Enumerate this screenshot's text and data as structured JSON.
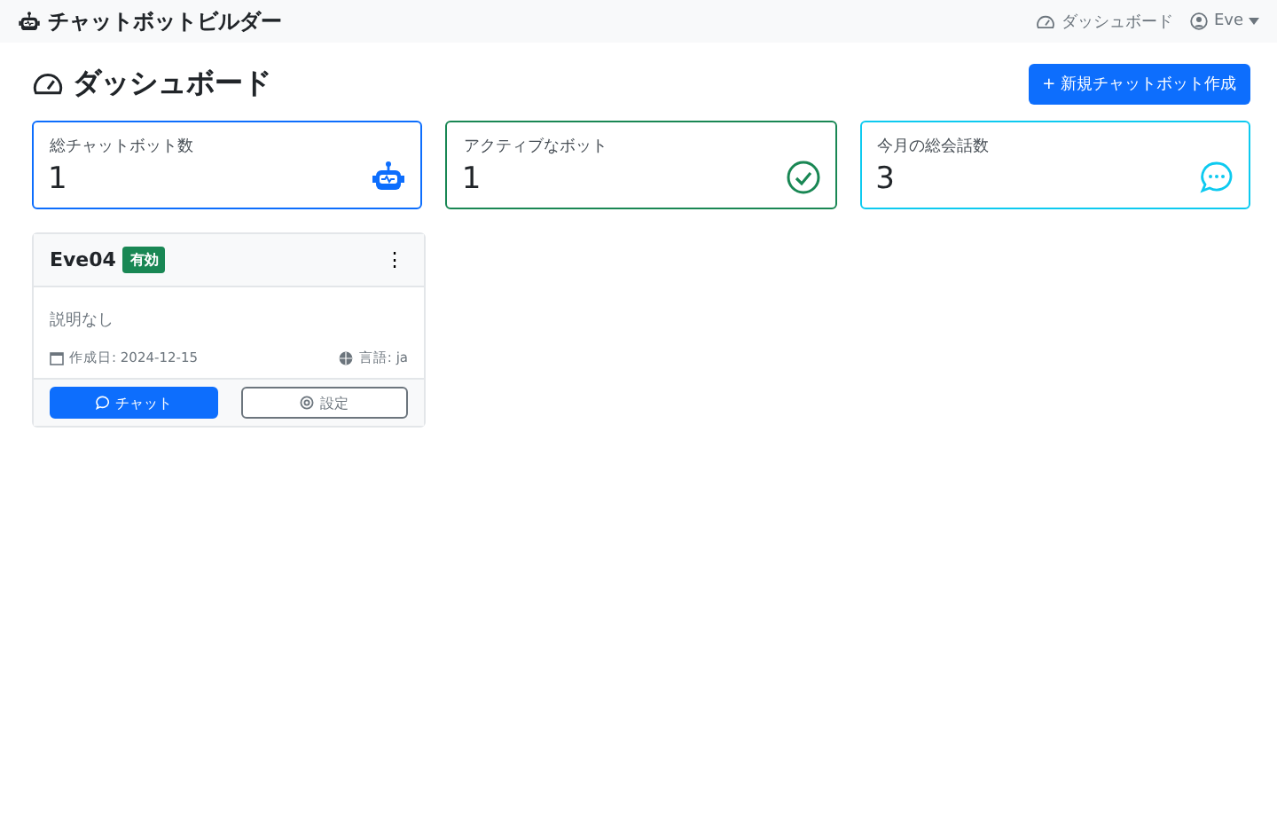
{
  "navbar": {
    "brand": "チャットボットビルダー",
    "links": [
      {
        "label": "ダッシュボード"
      }
    ],
    "user": "Eve"
  },
  "header": {
    "title": "ダッシュボード",
    "new_button": "+ 新規チャットボット作成"
  },
  "stats": [
    {
      "label": "総チャットボット数",
      "value": "1",
      "kind": "robot",
      "color": "#0d6efd"
    },
    {
      "label": "アクティブなボット",
      "value": "1",
      "kind": "check",
      "color": "#198754"
    },
    {
      "label": "今月の総会話数",
      "value": "3",
      "kind": "chat",
      "color": "#0dcaf0"
    }
  ],
  "bots": [
    {
      "name": "Eve04",
      "status": "有効",
      "active": true,
      "menu": "⋮",
      "description": "説明なし",
      "created": "作成日: 2024-12-15",
      "language": "言語: ja",
      "chat_button": "チャット",
      "settings_button": "設定"
    }
  ]
}
